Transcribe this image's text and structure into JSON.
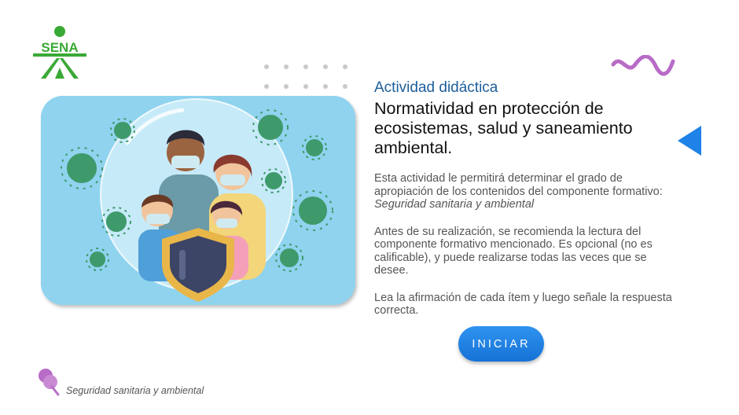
{
  "logo": {
    "text": "SENA",
    "color": "#39a935"
  },
  "activity": {
    "kicker": "Actividad didáctica",
    "title": "Normatividad en protección de ecosistemas, salud y saneamiento ambiental.",
    "p1_intro": "Esta actividad le permitirá determinar el grado de apropiación de los contenidos del componente formativo: ",
    "p1_component": "Seguridad sanitaria y ambiental",
    "p2": "Antes de su realización, se recomienda la lectura del componente formativo mencionado. Es opcional (no es calificable), y puede realizarse todas las veces que se desee.",
    "p3": "Lea la afirmación de cada ítem y luego señale la respuesta correcta."
  },
  "start_button": {
    "label": "INICIAR"
  },
  "footer": {
    "label": "Seguridad sanitaria y ambiental"
  },
  "colors": {
    "kicker": "#1d5e9c",
    "button": "#1f82e6",
    "back_arrow": "#1f82e6",
    "squiggle": "#b86bc7",
    "illustration_bg": "#8fd3ef",
    "virus": "#3f9a6b"
  },
  "icons": {
    "back": "triangle-left-icon",
    "footer": "pushpin-icon"
  }
}
